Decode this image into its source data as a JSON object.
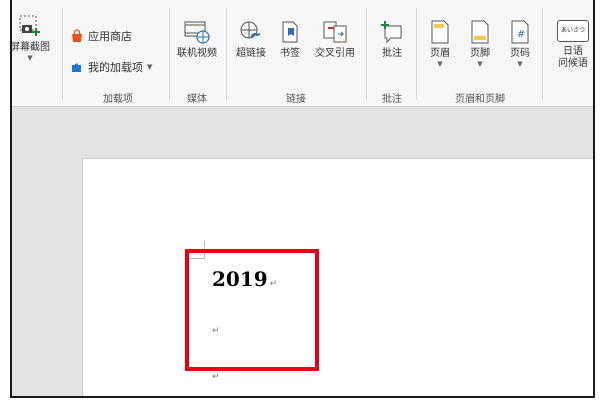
{
  "ribbon": {
    "screenshot": {
      "label": "屏幕截图"
    },
    "addins": {
      "store_label": "应用商店",
      "my_addins_label": "我的加载项",
      "group_label": "加载项"
    },
    "media": {
      "online_video_label": "联机视频",
      "group_label": "媒体"
    },
    "links": {
      "hyperlink_label": "超链接",
      "bookmark_label": "书签",
      "crossref_label": "交叉引用",
      "group_label": "链接"
    },
    "comments": {
      "comment_label": "批注",
      "group_label": "批注"
    },
    "header_footer": {
      "header_label": "页眉",
      "footer_label": "页脚",
      "page_number_label": "页码",
      "group_label": "页眉和页脚"
    },
    "greeting": {
      "icon_text": "あいさつ",
      "label_line1": "日语",
      "label_line2": "问候语"
    }
  },
  "document": {
    "line1": "2019",
    "para_mark": "↵"
  },
  "colors": {
    "highlight": "#e60012",
    "store_icon": "#e8541e",
    "addin_icon": "#1976d2"
  }
}
